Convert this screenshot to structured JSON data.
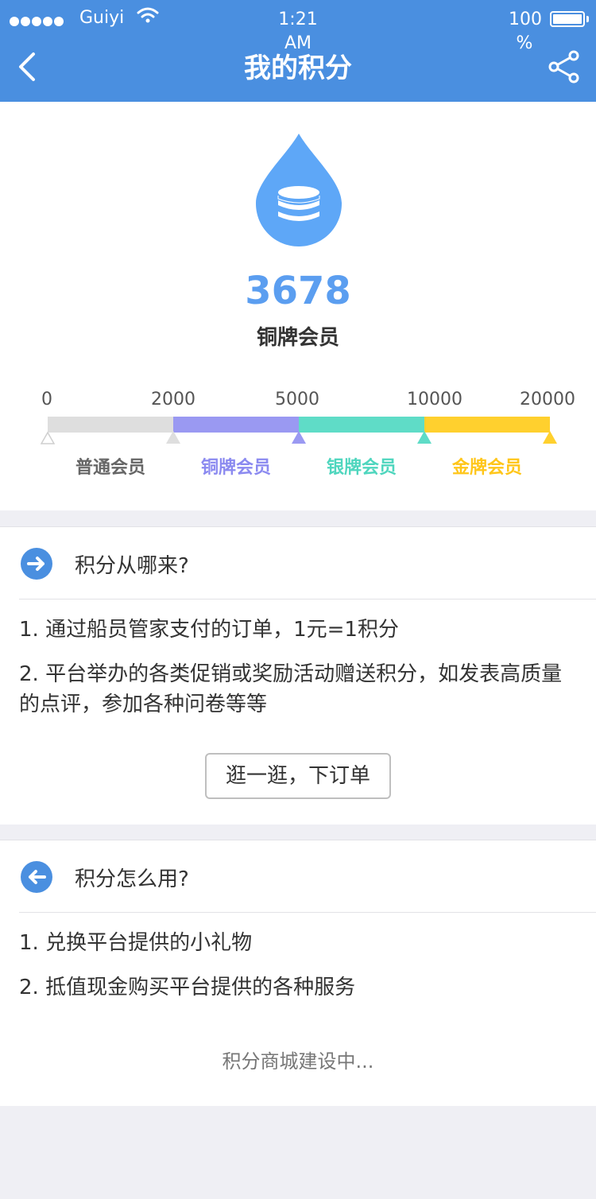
{
  "status_bar": {
    "carrier": "Guiyi",
    "time": "1:21 AM",
    "battery": "100 %"
  },
  "nav": {
    "title": "我的积分",
    "back_icon": "back-chevron-icon",
    "share_icon": "share-icon"
  },
  "summary": {
    "points": "3678",
    "level": "铜牌会员",
    "icon": "coin-drop-icon"
  },
  "levels": {
    "thresholds": [
      "0",
      "2000",
      "5000",
      "10000",
      "20000"
    ],
    "tiers": [
      {
        "name": "普通会员",
        "color": "#dedede"
      },
      {
        "name": "铜牌会员",
        "color": "#9a99f2"
      },
      {
        "name": "银牌会员",
        "color": "#5fdcc7"
      },
      {
        "name": "金牌会员",
        "color": "#ffd02e"
      }
    ],
    "tier_text_colors": [
      "#666666",
      "#8b8af0",
      "#4fd6be",
      "#ffc61a"
    ]
  },
  "earn": {
    "title": "积分从哪来?",
    "items": [
      "1. 通过船员管家支付的订单，1元=1积分",
      "2. 平台举办的各类促销或奖励活动赠送积分，如发表高质量的点评，参加各种问卷等等"
    ],
    "button": "逛一逛，下订单"
  },
  "use": {
    "title": "积分怎么用?",
    "items": [
      "1. 兑换平台提供的小礼物",
      "2. 抵值现金购买平台提供的各种服务"
    ],
    "note": "积分商城建设中..."
  },
  "colors": {
    "brand": "#4a8fe0",
    "points": "#5b9ef0"
  }
}
